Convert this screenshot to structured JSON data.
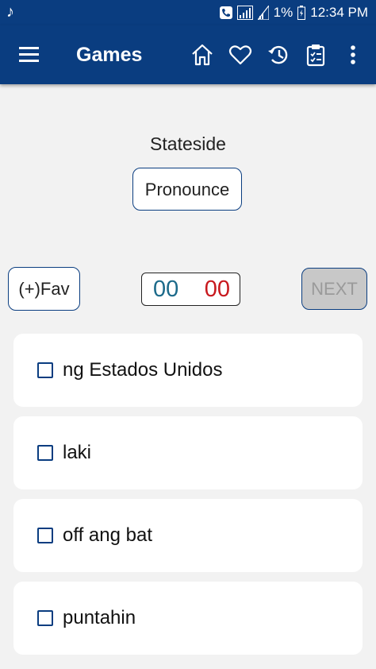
{
  "status_bar": {
    "music_icon": "music-note-icon",
    "battery": "1%",
    "time": "12:34 PM"
  },
  "app_bar": {
    "title": "Games",
    "icons": [
      "menu-icon",
      "home-icon",
      "heart-icon",
      "history-icon",
      "clipboard-icon",
      "more-vert-icon"
    ]
  },
  "quiz": {
    "word": "Stateside",
    "pronounce_label": "Pronounce",
    "fav_label": "(+)Fav",
    "score_correct": "00",
    "score_wrong": "00",
    "next_label": "NEXT",
    "options": [
      {
        "label": "ng Estados Unidos"
      },
      {
        "label": "laki"
      },
      {
        "label": "off ang bat"
      },
      {
        "label": "puntahin"
      }
    ]
  },
  "colors": {
    "primary": "#0a3d80",
    "background": "#f2f2f2",
    "correct": "#1c6a8a",
    "wrong": "#c8191e",
    "disabled": "#c8c8c8"
  }
}
